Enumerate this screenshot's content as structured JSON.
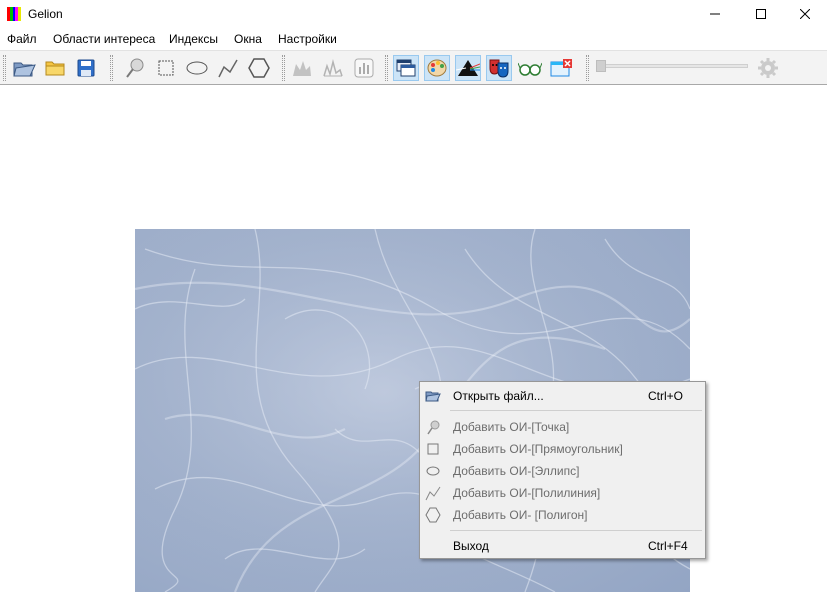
{
  "window": {
    "title": "Gelion",
    "icon_colors": [
      "#ff0000",
      "#00d000",
      "#0000ff",
      "#ff00ff",
      "#ffff00"
    ]
  },
  "menubar": {
    "items": [
      {
        "label": "Файл"
      },
      {
        "label": "Области интереса"
      },
      {
        "label": "Индексы"
      },
      {
        "label": "Окна"
      },
      {
        "label": "Настройки"
      }
    ]
  },
  "toolbar": {
    "buttons": [
      {
        "icon": "open-folder-icon"
      },
      {
        "icon": "folder-icon"
      },
      {
        "icon": "save-icon"
      },
      {
        "icon": "point-pin-icon"
      },
      {
        "icon": "rectangle-select-icon"
      },
      {
        "icon": "ellipse-select-icon"
      },
      {
        "icon": "polyline-icon"
      },
      {
        "icon": "polygon-icon"
      },
      {
        "icon": "leaf-chart-icon"
      },
      {
        "icon": "spectrum-icon"
      },
      {
        "icon": "bar-chart-icon"
      },
      {
        "icon": "windows-icon"
      },
      {
        "icon": "palette-icon"
      },
      {
        "icon": "prism-icon"
      },
      {
        "icon": "theater-masks-icon"
      },
      {
        "icon": "glasses-icon"
      },
      {
        "icon": "close-window-icon"
      },
      {
        "icon": "settings-gear-icon"
      }
    ]
  },
  "context_menu": {
    "items": [
      {
        "label": "Открыть файл...",
        "shortcut": "Ctrl+O",
        "enabled": true,
        "icon": "open-folder-icon"
      },
      {
        "label": "Добавить ОИ-[Точка]",
        "enabled": false,
        "icon": "point-pin-icon"
      },
      {
        "label": "Добавить ОИ-[Прямоугольник]",
        "enabled": false,
        "icon": "rectangle-icon"
      },
      {
        "label": "Добавить ОИ-[Эллипс]",
        "enabled": false,
        "icon": "ellipse-icon"
      },
      {
        "label": "Добавить ОИ-[Полилиния]",
        "enabled": false,
        "icon": "polyline-icon"
      },
      {
        "label": "Добавить ОИ- [Полигон]",
        "enabled": false,
        "icon": "polygon-icon"
      },
      {
        "label": "Выход",
        "shortcut": "Ctrl+F4",
        "enabled": true
      }
    ]
  }
}
